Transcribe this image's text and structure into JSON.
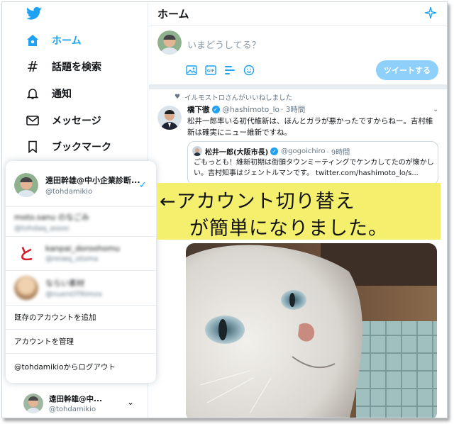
{
  "colors": {
    "accent": "#1da1f2",
    "note_bg": "#f4ef6c"
  },
  "nav": {
    "logo": "twitter-bird-icon",
    "items": [
      {
        "label": "ホーム",
        "icon": "home-icon",
        "active": true
      },
      {
        "label": "話題を検索",
        "icon": "hashtag-icon"
      },
      {
        "label": "通知",
        "icon": "bell-icon"
      },
      {
        "label": "メッセージ",
        "icon": "mail-icon"
      },
      {
        "label": "ブックマーク",
        "icon": "bookmark-icon"
      }
    ]
  },
  "account_popup": {
    "current": {
      "name": "遠田幹雄@中小企業診断...",
      "handle": "@tohdamikio"
    },
    "others": [
      {
        "name": "moto.sanu  のなごみ",
        "handle": "@tohdaq_assoc"
      },
      {
        "name": "kanpai_doroohomu",
        "handle": "@reiwq_otoma"
      },
      {
        "name": "ならい素材",
        "handle": "@nuenOTRimos"
      }
    ],
    "menu": [
      "既存のアカウントを追加",
      "アカウントを管理",
      "@tohdamikioからログアウト"
    ]
  },
  "bottom_account": {
    "name": "遠田幹雄@中...",
    "handle": "@tohdamikio"
  },
  "main": {
    "title": "ホーム",
    "compose_placeholder": "いまどうしてる？",
    "tweet_button": "ツイートする",
    "liked_by": "イルモストロさんがいいねしました",
    "tweet": {
      "name": "橋下徹",
      "handle": "@hashimoto_lo",
      "time": "· 3時間",
      "text": "松井一郎率いる初代維新は、ほんとガラが悪かったですからねー。吉村維新は確実にニュー維新ですね。",
      "quote": {
        "name": "松井一郎(大阪市長)",
        "handle": "@gogoichiro",
        "time": "· 9時間",
        "text": "ごもっとも！維新初期は街頭タウンミーティングでケンカしてたのが懐かしい。吉村知事はジェントルマンです。 twitter.com/hashimoto_lo/s..."
      }
    }
  },
  "annotation": {
    "line1": "←アカウント切り替え",
    "line2": "が簡単になりました。"
  }
}
